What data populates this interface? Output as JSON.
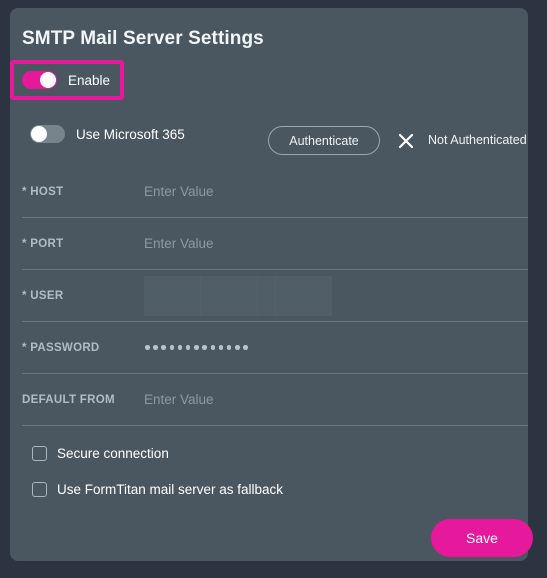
{
  "theme": {
    "page_background": "#2b3440",
    "card_background": "#4a5761",
    "accent": "#e6189b",
    "divider": "#687680",
    "label_color": "#b2bcc3",
    "text_color": "#ffffff",
    "placeholder_color": "#8e9aa2"
  },
  "panel": {
    "title": "SMTP Mail Server Settings"
  },
  "enable": {
    "label": "Enable",
    "state": "on",
    "highlighted": true
  },
  "microsoft365": {
    "label": "Use Microsoft 365",
    "state": "off"
  },
  "authenticate": {
    "button_label": "Authenticate",
    "status_icon": "close-x-icon",
    "status_label": "Not Authenticated"
  },
  "fields": [
    {
      "label": "* HOST",
      "name": "host",
      "value": "",
      "placeholder": "Enter Value",
      "type": "text",
      "required": true,
      "focused": false
    },
    {
      "label": "* PORT",
      "name": "port",
      "value": "",
      "placeholder": "Enter Value",
      "type": "text",
      "required": true,
      "focused": false
    },
    {
      "label": "* USER",
      "name": "user",
      "value": "",
      "placeholder": "",
      "type": "text",
      "required": true,
      "focused": true
    },
    {
      "label": "* PASSWORD",
      "name": "password",
      "value": "•••••••••••••",
      "masked_length": 13,
      "placeholder": "",
      "type": "password",
      "required": true,
      "focused": false
    },
    {
      "label": "DEFAULT FROM",
      "name": "default_from",
      "value": "",
      "placeholder": "Enter Value",
      "type": "text",
      "required": false,
      "focused": false
    }
  ],
  "checkboxes": [
    {
      "label": "Secure connection",
      "name": "secure-connection",
      "checked": false
    },
    {
      "label": "Use FormTitan mail server as fallback",
      "name": "formtitan-fallback",
      "checked": false
    }
  ],
  "actions": {
    "save_label": "Save"
  }
}
